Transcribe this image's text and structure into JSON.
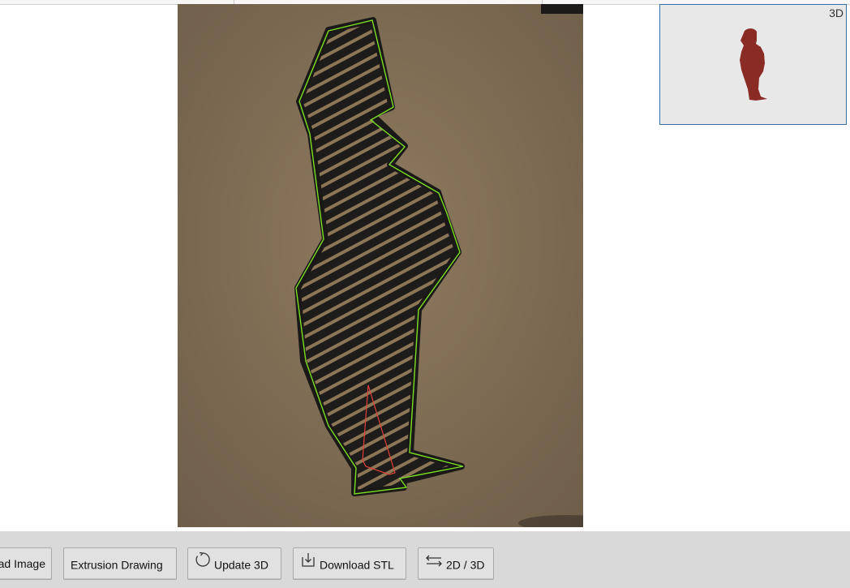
{
  "preview": {
    "label": "3D"
  },
  "toolbar": {
    "load_image_label": "Load Image",
    "extrusion_label": "Extrusion Drawing",
    "update_label": "Update 3D",
    "download_label": "Download STL",
    "toggle_label": "2D / 3D"
  },
  "icons": {
    "update": "refresh-icon",
    "download": "download-icon",
    "toggle": "swap-arrows-icon"
  },
  "colors": {
    "outline": "#7cde22",
    "hole": "#e0413a",
    "model": "#8b2b26",
    "toolbar_bg": "#d9d9d9",
    "preview_border": "#3b6ea5"
  }
}
